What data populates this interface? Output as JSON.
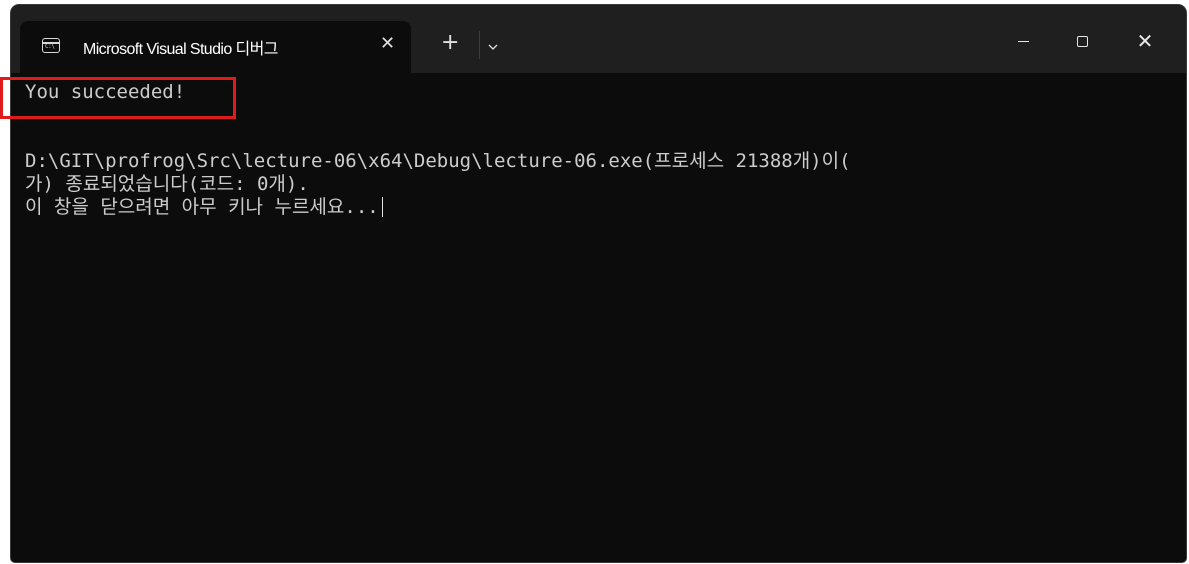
{
  "window": {
    "tab_title": "Microsoft Visual Studio 디버그",
    "tab_icon": "console-icon",
    "tab_icon_text": "C:\\",
    "tab_close_label": "✕",
    "new_tab_label": "+",
    "dropdown_icon": "chevron-down-icon",
    "minimize_icon": "minimize-icon",
    "maximize_icon": "maximize-icon",
    "close_label": "✕"
  },
  "console": {
    "lines": [
      "You succeeded!",
      "",
      "D:\\GIT\\profrog\\Src\\lecture-06\\x64\\Debug\\lecture-06.exe(프로세스 21388개)이(",
      "가) 종료되었습니다(코드: 0개).",
      "이 창을 닫으려면 아무 키나 누르세요..."
    ]
  },
  "colors": {
    "background": "#0c0c0c",
    "titlebar": "#1f1f1f",
    "text": "#cccccc",
    "highlight_border": "#e01b1b"
  }
}
